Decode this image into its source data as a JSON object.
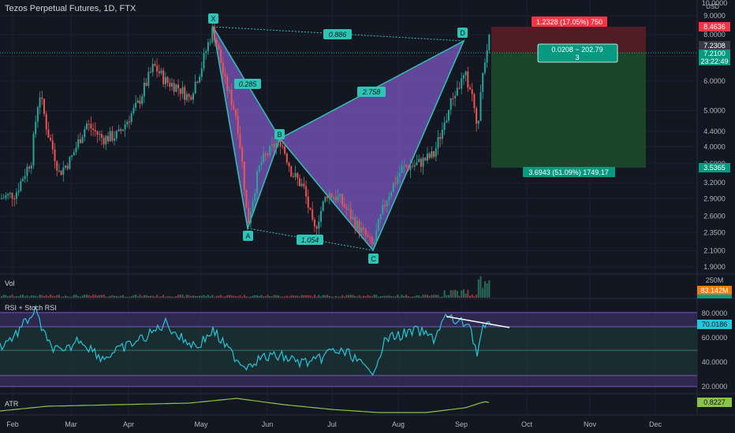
{
  "header": {
    "symbol": "Tezos Perpetual Futures, 1D, FTX"
  },
  "panes": {
    "volume": {
      "label": "Vol",
      "ticks": [
        "250M"
      ]
    },
    "rsi": {
      "label": "RSI + Stoch RSI",
      "ticks": [
        "80.0000",
        "60.0000",
        "40.0000",
        "20.0000"
      ]
    },
    "atr": {
      "label": "ATR"
    }
  },
  "price_axis": {
    "unit": "USD",
    "ticks": [
      "10.0000",
      "9.0000",
      "8.0000",
      "7.0000",
      "6.0000",
      "5.0000",
      "4.4000",
      "4.0000",
      "3.6000",
      "3.2000",
      "2.9000",
      "2.6000",
      "2.3500",
      "2.1000",
      "1.9000"
    ]
  },
  "time_axis": {
    "labels": [
      "Feb",
      "Mar",
      "Apr",
      "May",
      "Jun",
      "Jul",
      "Aug",
      "Sep",
      "Oct",
      "Nov",
      "Dec"
    ]
  },
  "badges": {
    "stop_price": "8.4636",
    "last_close": "7.2308",
    "current_price": "7.2100",
    "countdown": "23:22:49",
    "target_price": "3.5365",
    "vol_value": "83.142M",
    "vol_value2": "8.57M",
    "rsi_value": "70.0186",
    "atr_value": "0.8227"
  },
  "colors": {
    "background": "#131722",
    "bull": "#26a69a",
    "bear": "#ef5350",
    "pattern_fill": "#7e57c2",
    "pattern_line": "#2ec4b6",
    "profit_zone": "#1b5e20",
    "stop_zone": "#7f1d1d",
    "rsi_line": "#26c6da"
  },
  "chart_data": {
    "type": "candlestick",
    "title": "Tezos Perpetual Futures, 1D, FTX",
    "y_scale": "log",
    "ylim": [
      1.8,
      10.0
    ],
    "harmonic_pattern": {
      "points": [
        {
          "label": "X",
          "date": "May 01",
          "price": 8.3
        },
        {
          "label": "A",
          "date": "May 20",
          "price": 2.4
        },
        {
          "label": "B",
          "date": "Jun 01",
          "price": 4.2
        },
        {
          "label": "C",
          "date": "Jul 20",
          "price": 2.1
        },
        {
          "label": "D",
          "date": "Sep 10",
          "price": 7.6
        }
      ],
      "ratios": [
        {
          "label": "0.886",
          "from": "X",
          "to": "D"
        },
        {
          "label": "0.285",
          "from": "X",
          "to": "B"
        },
        {
          "label": "2.758",
          "from": "B",
          "to": "D"
        },
        {
          "label": "1.054",
          "from": "A",
          "to": "C"
        }
      ]
    },
    "short_position": {
      "entry": 7.21,
      "stop": 8.4636,
      "target": 3.5365,
      "stop_label": "1.2328 (17.05%) 750",
      "center_label": "0.0208 ~ 202.79",
      "center_sub": "3",
      "target_label": "3.6943 (51.09%) 1749.17"
    },
    "rsi": {
      "ylim": [
        20,
        80
      ],
      "last": 70.0186,
      "overbought": 70,
      "oversold": 30
    },
    "atr": {
      "last": 0.8227
    }
  }
}
